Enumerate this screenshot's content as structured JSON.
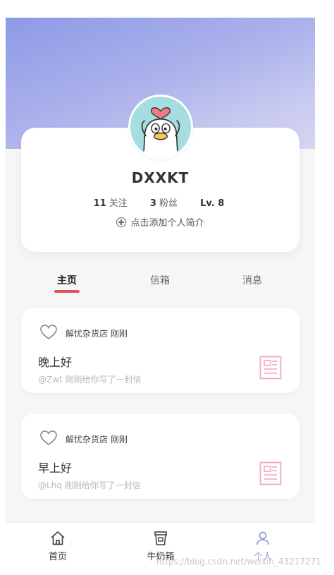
{
  "profile": {
    "username": "DXXKT",
    "stats": [
      {
        "value": "11",
        "label": "关注"
      },
      {
        "value": "3",
        "label": "粉丝"
      },
      {
        "value": "Lv. 8",
        "label": ""
      }
    ],
    "bio_action": "点击添加个人简介"
  },
  "tabs": [
    "主页",
    "信箱",
    "消息"
  ],
  "letters": [
    {
      "sender": "解忧杂货店 刚刚",
      "title": "晚上好",
      "subtitle": "@Zwt 刚刚给你写了一封信"
    },
    {
      "sender": "解忧杂货店 刚刚",
      "title": "早上好",
      "subtitle": "@Lhq 刚刚给你写了一封信"
    }
  ],
  "nav": [
    {
      "label": "首页",
      "icon": "home-icon"
    },
    {
      "label": "牛奶箱",
      "icon": "milk-box-icon"
    },
    {
      "label": "个人",
      "icon": "person-icon"
    }
  ],
  "watermark": "https://blog.csdn.net/weixin_43217271",
  "colors": {
    "accent": "#8c95d6",
    "tab_underline": "#e7505a",
    "doc_icon": "#f2a7bb",
    "avatar_bg": "#a6dee0"
  }
}
